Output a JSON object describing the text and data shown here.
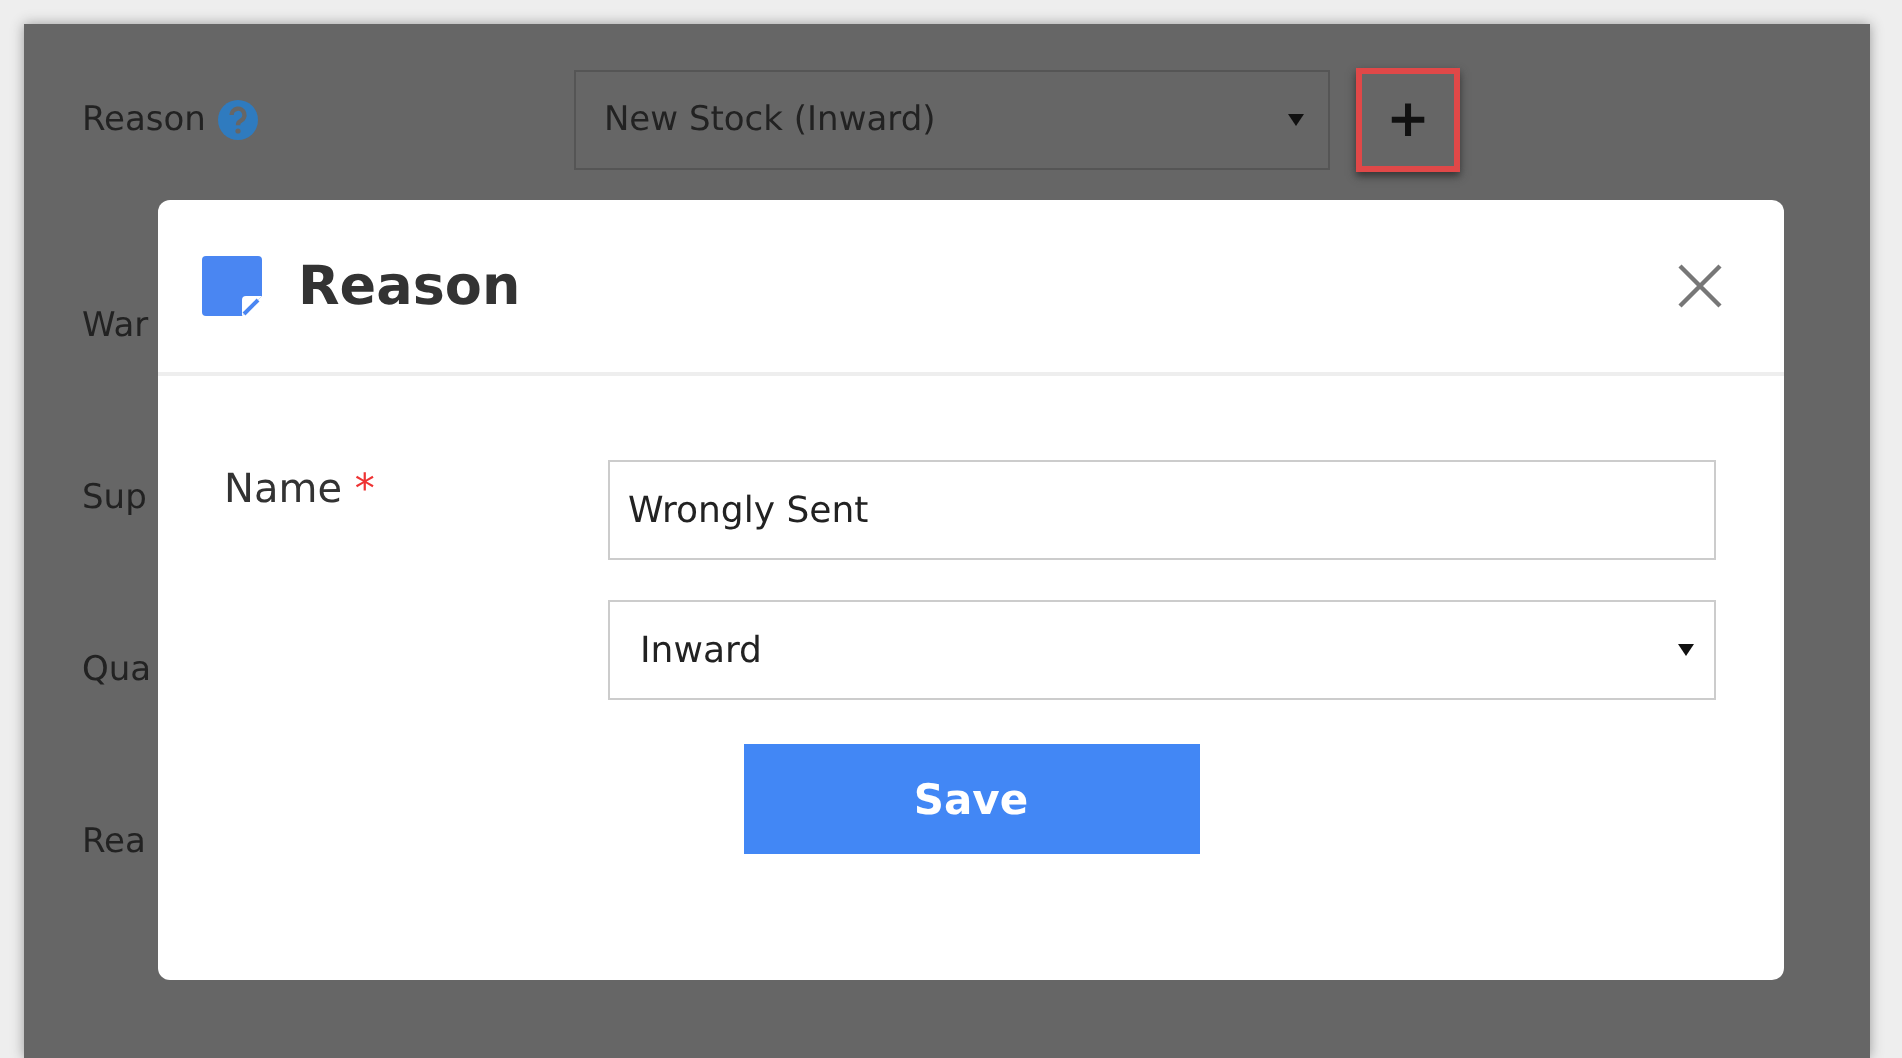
{
  "form": {
    "reason_label": "Reason",
    "reason_value": "New Stock (Inward)",
    "partial_labels": [
      "War",
      "Sup",
      "Qua",
      "Rea"
    ],
    "add_button": "+"
  },
  "dialog": {
    "title": "Reason",
    "name_label": "Name",
    "required_mark": "*",
    "name_value": "Wrongly Sent",
    "type_value": "Inward",
    "save_button": "Save"
  }
}
